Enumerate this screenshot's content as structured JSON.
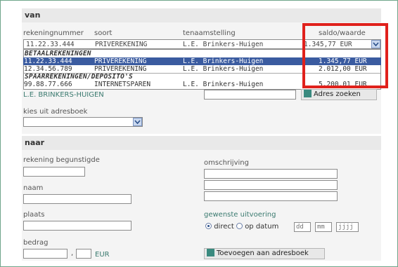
{
  "van": {
    "heading": "van",
    "columns": [
      "rekeningnummer",
      "soort",
      "tenaamstelling",
      "saldo/waarde"
    ],
    "selected": {
      "number": "11.22.33.444",
      "type": "PRIVEREKENING",
      "holder": "L.E. Brinkers-Huigen",
      "amount": "1.345,77 EUR"
    },
    "groups": [
      {
        "title": "BETAALREKENINGEN",
        "rows": [
          {
            "number": "11.22.33.444",
            "type": "PRIVEREKENING",
            "holder": "L.E. Brinkers-Huigen",
            "amount": "1.345,77 EUR",
            "selected": true
          },
          {
            "number": "12.34.56.789",
            "type": "PRIVEREKENING",
            "holder": "L.E. Brinkers-Huigen",
            "amount": "2.012,00 EUR",
            "selected": false
          }
        ]
      },
      {
        "title": "SPAARREKENINGEN/DEPOSITO'S",
        "rows": [
          {
            "number": "99.88.77.666",
            "type": "INTERNETSPAREN",
            "holder": "L.E. Brinkers-Huigen",
            "amount": "5.200,01 EUR",
            "selected": false
          }
        ]
      }
    ],
    "name_link": "L.E. BRINKERS-HUIGEN",
    "address_button": "Adres zoeken",
    "addressbook_label": "kies uit adresboek",
    "addressbook_value": ""
  },
  "naar": {
    "heading": "naar",
    "beneficiary_account_label": "rekening begunstigde",
    "name_label": "naam",
    "place_label": "plaats",
    "amount_label": "bedrag",
    "amount_separator": ",",
    "currency": "EUR",
    "description_label": "omschrijving",
    "execution_label": "gewenste uitvoering",
    "option_direct": "direct",
    "option_date": "op datum",
    "dd_placeholder": "dd",
    "mm_placeholder": "mm",
    "yyyy_placeholder": "jjjj",
    "add_button": "Toevoegen aan adresboek"
  },
  "colors": {
    "highlight_box": "#e0211c",
    "selection": "#3a5ba0",
    "accent": "#3a7a6f"
  }
}
